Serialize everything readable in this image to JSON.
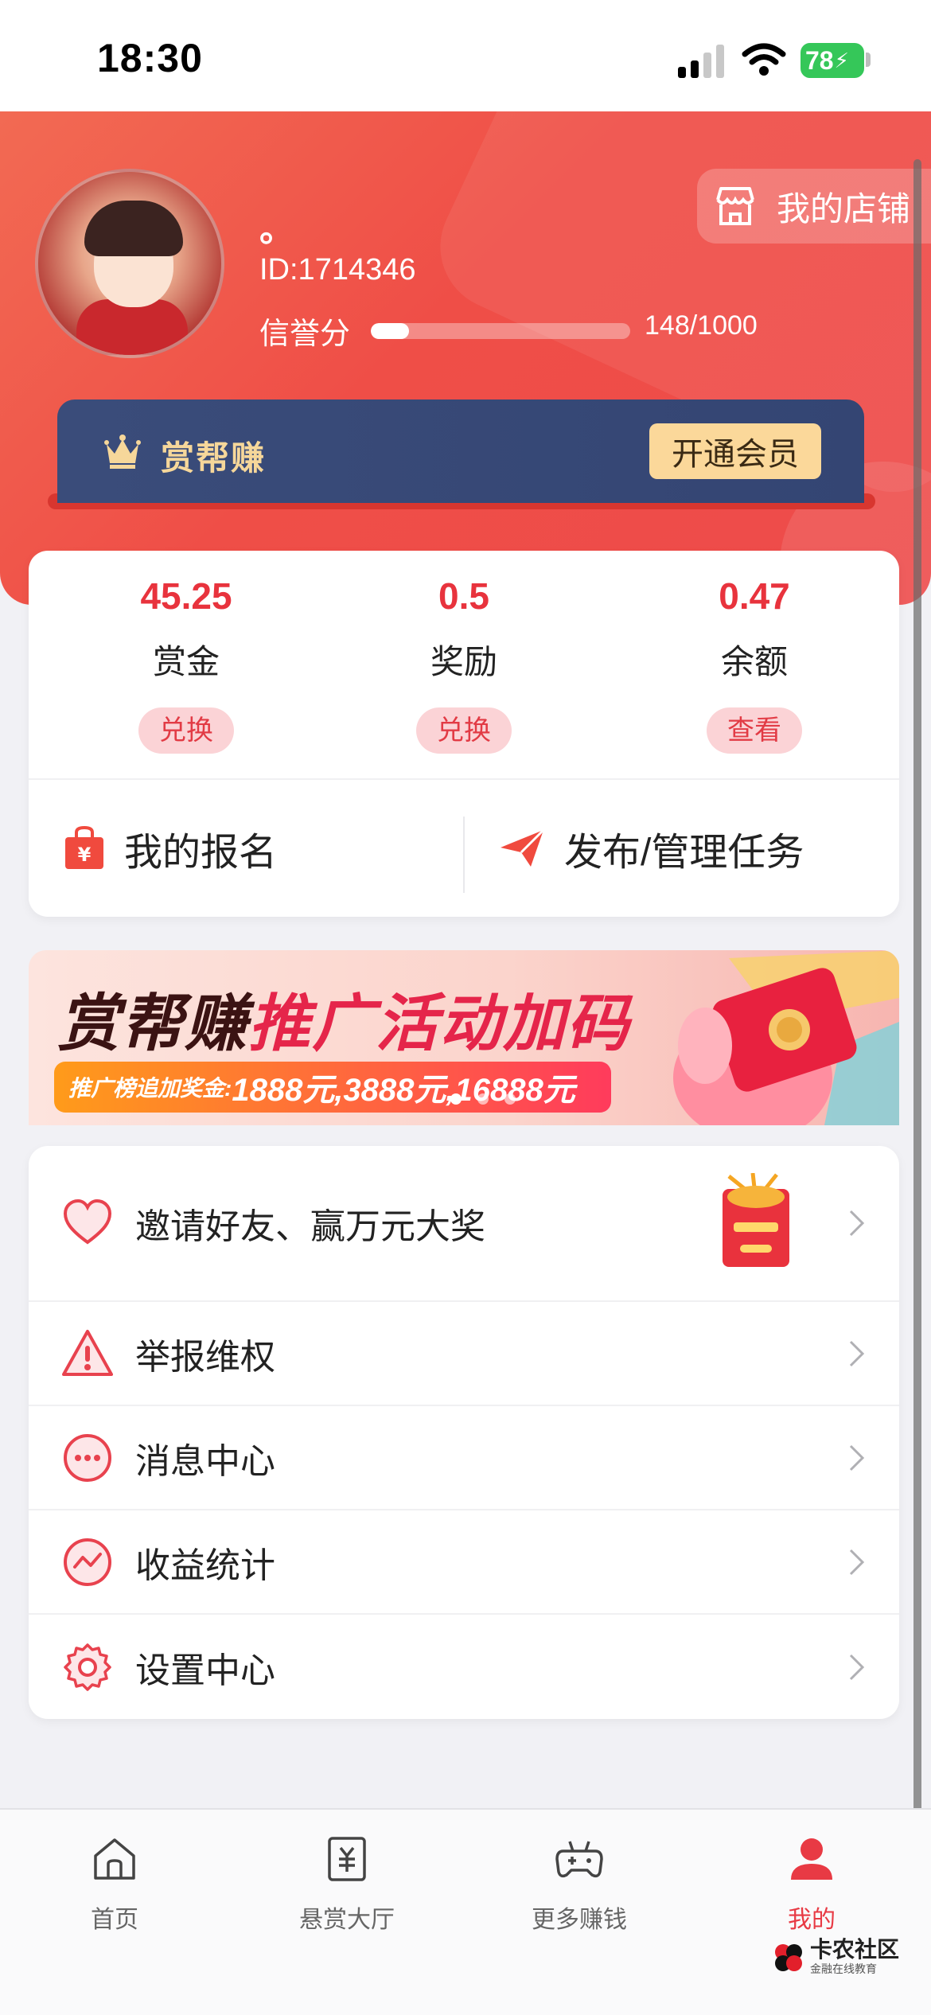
{
  "status_bar": {
    "time": "18:30",
    "battery": "78"
  },
  "header": {
    "username": "。",
    "user_id": "ID:1714346",
    "credit_label": "信誉分",
    "credit_value": "148/1000",
    "credit_progress": 0.148,
    "shop_label": "我的店铺",
    "vip_title": "赏帮赚",
    "vip_button": "开通会员"
  },
  "wallet": {
    "stats": [
      {
        "value": "45.25",
        "label": "赏金",
        "action": "兑换"
      },
      {
        "value": "0.5",
        "label": "奖励",
        "action": "兑换"
      },
      {
        "value": "0.47",
        "label": "余额",
        "action": "查看"
      }
    ],
    "my_signup": "我的报名",
    "publish_tasks": "发布/管理任务"
  },
  "promo": {
    "title_part1": "赏帮赚",
    "title_part2": "推广活动加码",
    "subtitle_prefix": "推广榜追加奖金:",
    "subtitle_amounts": "1888元,3888元,16888元"
  },
  "menu": {
    "items": [
      {
        "label": "邀请好友、赢万元大奖",
        "icon": "heart-icon"
      },
      {
        "label": "举报维权",
        "icon": "warning-icon"
      },
      {
        "label": "消息中心",
        "icon": "message-icon"
      },
      {
        "label": "收益统计",
        "icon": "stats-icon"
      },
      {
        "label": "设置中心",
        "icon": "settings-icon"
      }
    ]
  },
  "tabs": [
    {
      "label": "首页",
      "icon": "home-icon",
      "active": false
    },
    {
      "label": "悬赏大厅",
      "icon": "reward-hall-icon",
      "active": false
    },
    {
      "label": "更多赚钱",
      "icon": "gamepad-icon",
      "active": false
    },
    {
      "label": "我的",
      "icon": "profile-icon",
      "active": true
    }
  ],
  "watermark": {
    "text": "卡农社区",
    "sub": "金融在线教育"
  },
  "colors": {
    "primary_red": "#ee4b4b",
    "accent_red": "#e8333d",
    "vip_navy": "#3a4c7a",
    "vip_gold": "#f6d79a"
  }
}
